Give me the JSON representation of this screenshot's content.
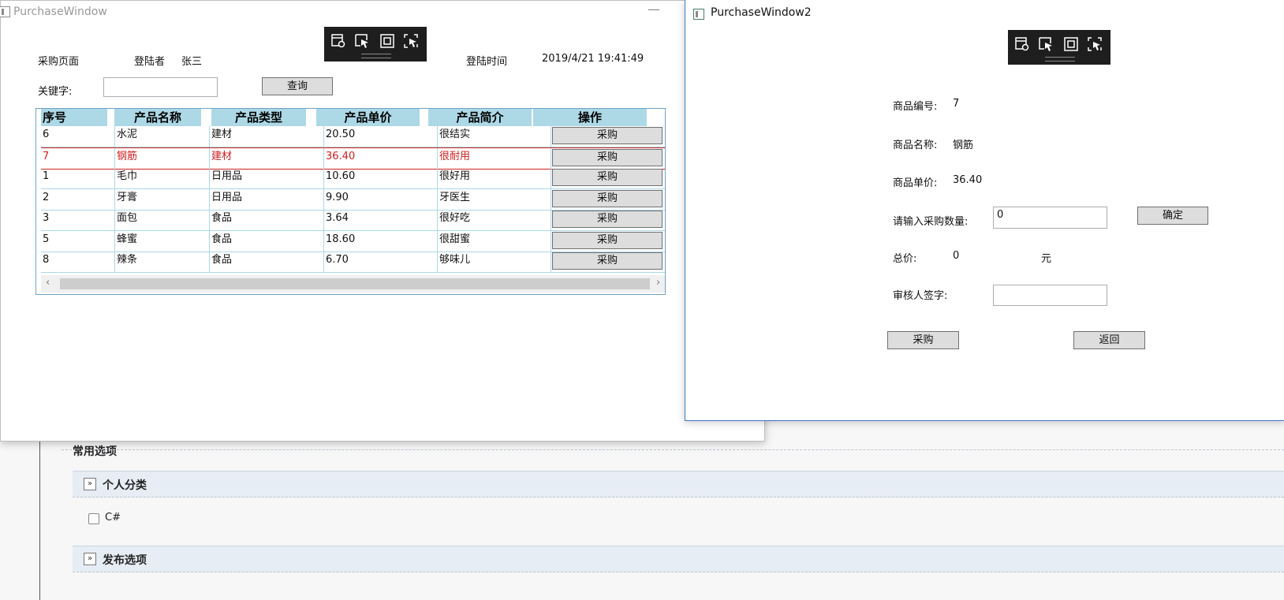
{
  "background": {
    "section_cut": "常用选项",
    "section_personal": "个人分类",
    "checkbox_label": "C#",
    "section_publish": "发布选项",
    "chevron": "»"
  },
  "window1": {
    "title": "PurchaseWindow",
    "minimize": "—",
    "page_label": "采购页面",
    "login_user_label": "登陆者",
    "login_user": "张三",
    "login_time_label": "登陆时间",
    "login_time": "2019/4/21 19:41:49",
    "keyword_label": "关键字:",
    "keyword_value": "",
    "query_button": "查询",
    "grid": {
      "headers": [
        "序号",
        "产品名称",
        "产品类型",
        "产品单价",
        "产品简介",
        "操作"
      ],
      "rows": [
        {
          "id": "6",
          "name": "水泥",
          "type": "建材",
          "price": "20.50",
          "desc": "很结实",
          "action": "采购"
        },
        {
          "id": "7",
          "name": "钢筋",
          "type": "建材",
          "price": "36.40",
          "desc": "很耐用",
          "action": "采购"
        },
        {
          "id": "1",
          "name": "毛巾",
          "type": "日用品",
          "price": "10.60",
          "desc": "很好用",
          "action": "采购"
        },
        {
          "id": "2",
          "name": "牙膏",
          "type": "日用品",
          "price": "9.90",
          "desc": "牙医生",
          "action": "采购"
        },
        {
          "id": "3",
          "name": "面包",
          "type": "食品",
          "price": "3.64",
          "desc": "很好吃",
          "action": "采购"
        },
        {
          "id": "5",
          "name": "蜂蜜",
          "type": "食品",
          "price": "18.60",
          "desc": "很甜蜜",
          "action": "采购"
        },
        {
          "id": "8",
          "name": "辣条",
          "type": "食品",
          "price": "6.70",
          "desc": "够味儿",
          "action": "采购"
        }
      ],
      "selected_row_index": 1,
      "scroll_left": "‹",
      "scroll_right": "›"
    }
  },
  "window2": {
    "title": "PurchaseWindow2",
    "product_id_label": "商品编号:",
    "product_id": "7",
    "product_name_label": "商品名称:",
    "product_name": "钢筋",
    "product_price_label": "商品单价:",
    "product_price": "36.40",
    "quantity_label": "请输入采购数量:",
    "quantity_value": "0",
    "confirm_button": "确定",
    "total_label": "总价:",
    "total_value": "0",
    "currency": "元",
    "reviewer_label": "审核人签字:",
    "reviewer_value": "",
    "purchase_button": "采购",
    "back_button": "返回"
  },
  "colors": {
    "grid_header": "#add8e6",
    "selected_row_text": "#d02020",
    "devbar": "#1e1e1e"
  },
  "icons": [
    "window-icon",
    "live-visual-tree-icon",
    "select-element-icon",
    "display-layout-adorners-icon",
    "track-focus-icon"
  ]
}
